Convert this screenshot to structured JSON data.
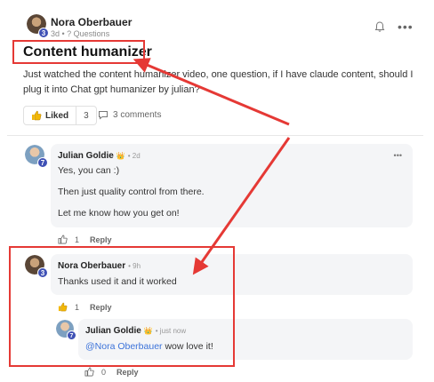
{
  "post": {
    "author": "Nora Oberbauer",
    "level": "3",
    "meta": "3d • ? Questions",
    "title": "Content humanizer",
    "body": "Just watched the content humanizer video, one question, if I have claude content, should I plug it into Chat gpt humanizer by julian?",
    "liked_label": "Liked",
    "like_count": "3",
    "comments_label": "3 comments"
  },
  "comments": [
    {
      "author": "Julian Goldie",
      "badge": "👑",
      "level": "7",
      "meta": "• 2d",
      "lines": [
        "Yes, you can :)",
        "Then just quality control from there.",
        "Let me know how you get on!"
      ],
      "like_count": "1",
      "reply_label": "Reply"
    },
    {
      "author": "Nora Oberbauer",
      "level": "3",
      "meta": "• 9h",
      "lines": [
        "Thanks used it and it worked"
      ],
      "like_count": "1",
      "reply_label": "Reply"
    },
    {
      "author": "Julian Goldie",
      "badge": "👑",
      "level": "7",
      "meta": "• just now",
      "mention": "@Nora Oberbauer",
      "text": " wow love it!",
      "like_count": "0",
      "reply_label": "Reply"
    }
  ],
  "colors": {
    "accent": "#e53935",
    "level_badge": "#3f51b5",
    "mention": "#3b72d9"
  },
  "icons": [
    "bell-icon",
    "more-dots-icon",
    "thumbs-up-icon",
    "comment-icon"
  ]
}
